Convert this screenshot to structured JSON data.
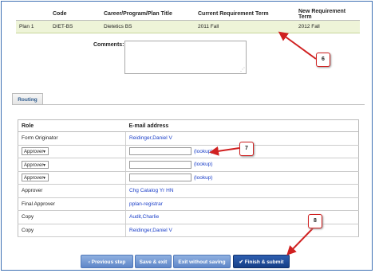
{
  "plan_table": {
    "headers": [
      "",
      "Code",
      "Career/Program/Plan Title",
      "Current Requirement Term",
      "New Requirement Term"
    ],
    "row": {
      "plan": "Plan 1",
      "code": "DIET-BS",
      "title": "Dietetics BS",
      "current_term": "2011 Fall",
      "new_term": "2012 Fall"
    }
  },
  "comments": {
    "label": "Comments:",
    "value": ""
  },
  "tab": {
    "label": "Routing"
  },
  "routing": {
    "headers": {
      "role": "Role",
      "email": "E-mail address"
    },
    "rows": [
      {
        "role": "Form Originator",
        "email": "Reidinger,Daniel V"
      },
      {
        "role_select": "Approver",
        "lookup": "(lookup)"
      },
      {
        "role_select": "Approver",
        "lookup": "(lookup)"
      },
      {
        "role_select": "Approver",
        "lookup": "(lookup)"
      },
      {
        "role": "Approver",
        "email": "Chg Catalog Yr HN"
      },
      {
        "role": "Final Approver",
        "email": "pplan-registrar"
      },
      {
        "role": "Copy",
        "email": "Audit,Charlie"
      },
      {
        "role": "Copy",
        "email": "Reidinger,Daniel V"
      }
    ]
  },
  "buttons": {
    "previous": "Previous step",
    "save_exit": "Save & exit",
    "exit_no_save": "Exit without saving",
    "finish": "Finish & submit"
  },
  "callouts": {
    "c6": "6",
    "c7": "7",
    "c8": "8"
  },
  "colors": {
    "accent": "#153e87",
    "callout_border": "#d02020",
    "link": "#1a3ec8"
  }
}
